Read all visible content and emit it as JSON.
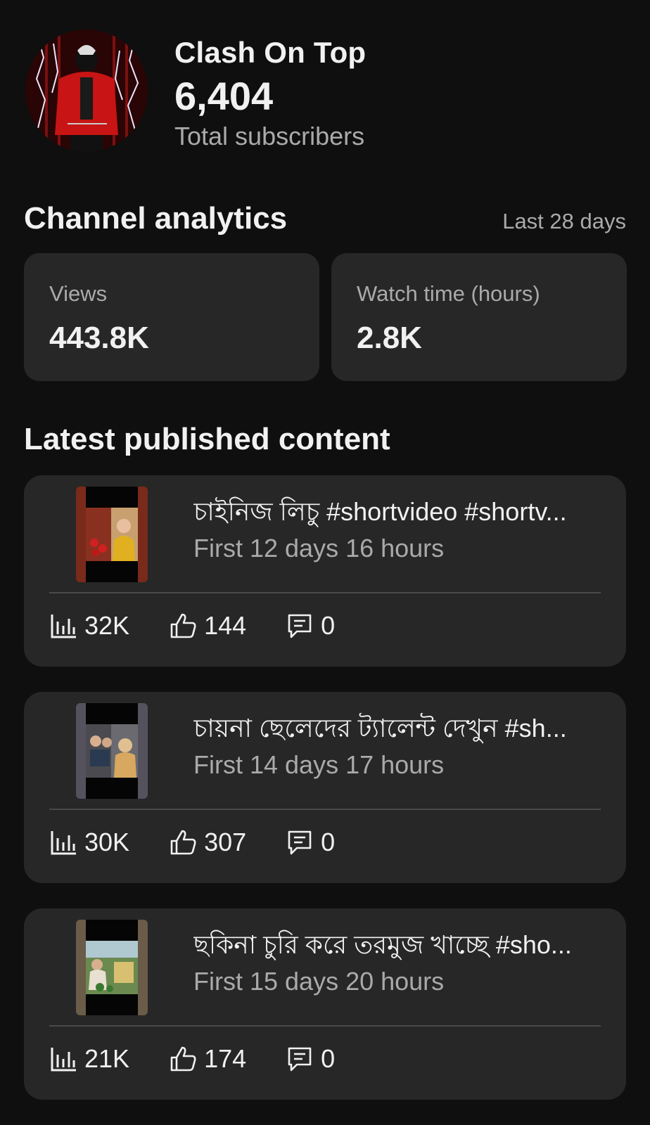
{
  "channel": {
    "name": "Clash On Top",
    "subscriber_count": "6,404",
    "subscriber_label": "Total subscribers"
  },
  "analytics": {
    "title": "Channel analytics",
    "period": "Last 28 days",
    "cards": [
      {
        "label": "Views",
        "value": "443.8K"
      },
      {
        "label": "Watch time (hours)",
        "value": "2.8K"
      }
    ]
  },
  "latest": {
    "title": "Latest published content",
    "items": [
      {
        "title": "চাইনিজ লিচু #shortvideo  #shortv...",
        "meta": "First 12 days 16 hours",
        "views": "32K",
        "likes": "144",
        "comments": "0",
        "thumb_border": "#7a2a1a"
      },
      {
        "title": "চায়না  ছেলেদের ট্যালেন্ট  দেখুন #sh...",
        "meta": "First 14 days 17 hours",
        "views": "30K",
        "likes": "307",
        "comments": "0",
        "thumb_border": "#55525e"
      },
      {
        "title": "ছকিনা চুরি করে তরমুজ খাচ্ছে #sho...",
        "meta": "First 15 days 20 hours",
        "views": "21K",
        "likes": "174",
        "comments": "0",
        "thumb_border": "#6a5c48"
      }
    ]
  },
  "icons": {
    "views": "bar-chart-icon",
    "likes": "thumbs-up-icon",
    "comments": "comment-icon"
  },
  "colors": {
    "background": "#0f0f0f",
    "card": "#272727",
    "secondary_text": "#aaaaaa"
  }
}
